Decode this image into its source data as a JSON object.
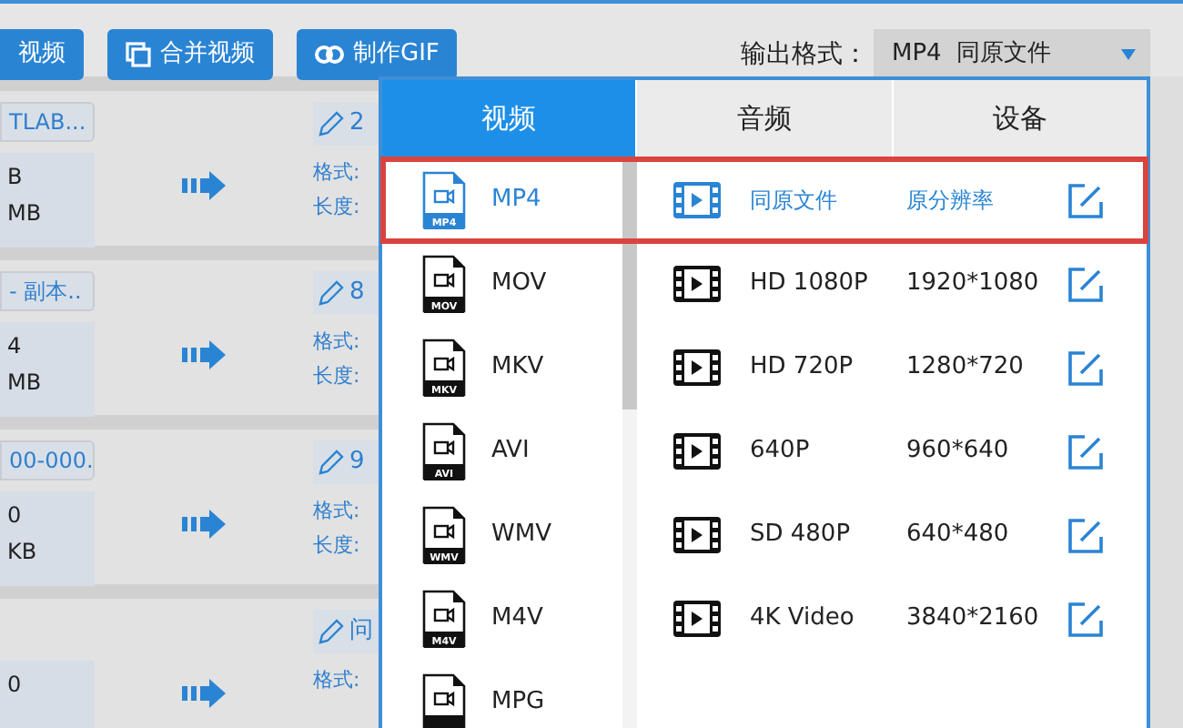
{
  "toolbar": {
    "buttons": [
      {
        "label": "视频",
        "kind": "plain"
      },
      {
        "label": "合并视频",
        "kind": "merge"
      },
      {
        "label": "制作GIF",
        "kind": "gif"
      }
    ]
  },
  "output_format": {
    "label": "输出格式：",
    "value": "MP4  同原文件"
  },
  "files": [
    {
      "name": "TLAB...",
      "info": [
        "B",
        "MB"
      ],
      "output_name": "2",
      "fields": [
        "格式:",
        "长度:"
      ]
    },
    {
      "name": "- 副本..",
      "info": [
        "4",
        "MB"
      ],
      "output_name": "8",
      "fields": [
        "格式:",
        "长度:"
      ]
    },
    {
      "name": "00-000.",
      "info": [
        "0",
        "KB"
      ],
      "output_name": "9",
      "fields": [
        "格式:",
        "长度:"
      ]
    },
    {
      "info": [
        "0"
      ],
      "output_name": "问",
      "fields": [
        "格式:"
      ]
    }
  ],
  "popup": {
    "tabs": [
      {
        "label": "视频",
        "selected": true
      },
      {
        "label": "音频",
        "selected": false
      },
      {
        "label": "设备",
        "selected": false
      }
    ],
    "formats": [
      {
        "label": "MP4",
        "icon_label": "MP4",
        "selected": true
      },
      {
        "label": "MOV",
        "icon_label": "MOV",
        "selected": false
      },
      {
        "label": "MKV",
        "icon_label": "MKV",
        "selected": false
      },
      {
        "label": "AVI",
        "icon_label": "AVI",
        "selected": false
      },
      {
        "label": "WMV",
        "icon_label": "WMV",
        "selected": false
      },
      {
        "label": "M4V",
        "icon_label": "M4V",
        "selected": false
      },
      {
        "label": "MPG",
        "selected": false
      }
    ],
    "presets": [
      {
        "name": "同原文件",
        "resolution": "原分辨率",
        "selected": true
      },
      {
        "name": "HD 1080P",
        "resolution": "1920*1080",
        "selected": false
      },
      {
        "name": "HD 720P",
        "resolution": "1280*720",
        "selected": false
      },
      {
        "name": "640P",
        "resolution": "960*640",
        "selected": false
      },
      {
        "name": "SD 480P",
        "resolution": "640*480",
        "selected": false
      },
      {
        "name": "4K Video",
        "resolution": "3840*2160",
        "selected": false
      }
    ]
  }
}
